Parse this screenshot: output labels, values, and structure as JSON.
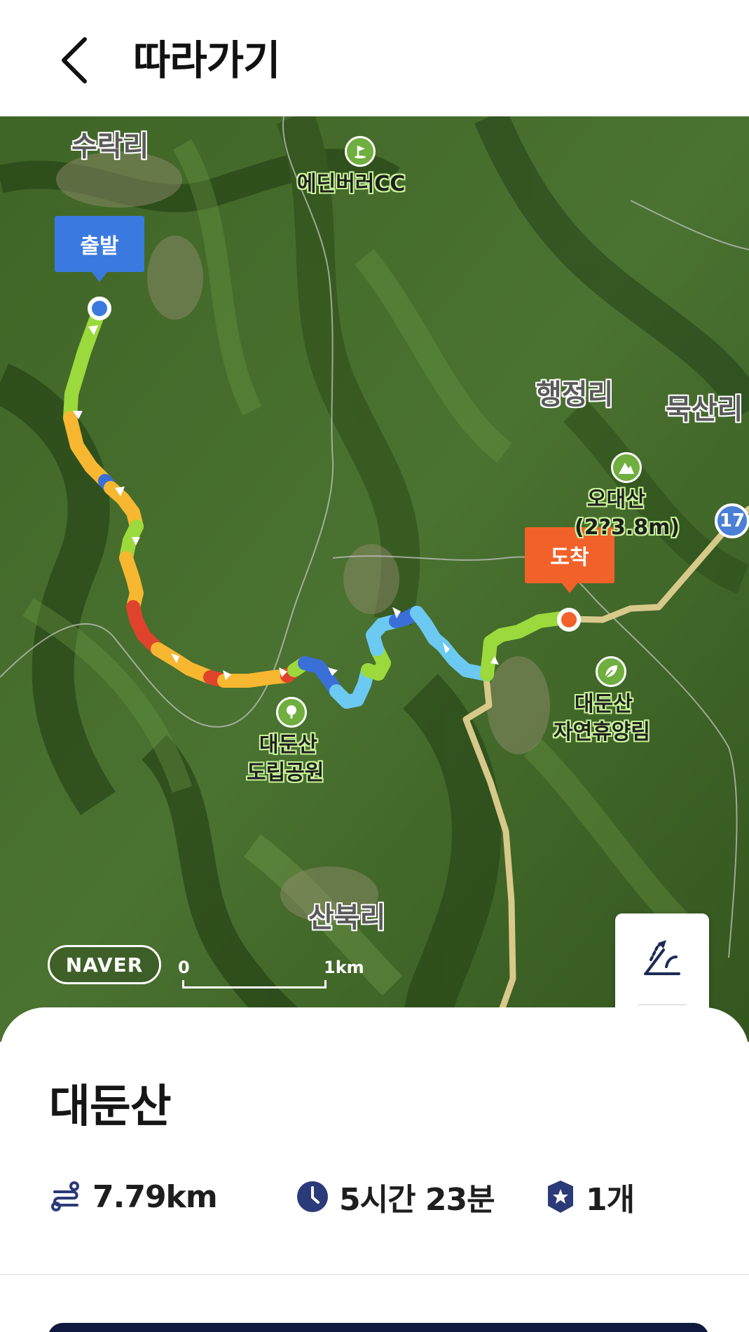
{
  "header": {
    "title": "따라가기",
    "back_icon": "chevron-left-icon"
  },
  "map": {
    "provider_logo": "NAVER",
    "scale": {
      "zero": "0",
      "distance": "1km"
    },
    "villages": [
      "수락리",
      "행정리",
      "묵산리",
      "산북리"
    ],
    "pois": {
      "golf": "에딘버러CC",
      "peak_name": "오대산",
      "peak_height": "(2?3.8m)",
      "forest_line1": "대둔산",
      "forest_line2": "자연휴양림",
      "park_line1": "대둔산",
      "park_line2": "도립공원"
    },
    "route_number": "17",
    "markers": {
      "start": "출발",
      "end": "도착"
    },
    "colors": {
      "start_marker": "#3a7ae0",
      "end_marker": "#f2612a",
      "road": "#d7c98a",
      "route_green": "#9bd93c",
      "route_yellow": "#f7b731",
      "route_red": "#e0432b",
      "route_blue": "#3a6fd8",
      "route_cyan": "#6cc9f2"
    },
    "controls": [
      "elevation-profile-icon",
      "reverse-route-icon"
    ]
  },
  "trail": {
    "name": "대둔산",
    "distance": "7.79km",
    "duration": "5시간 23분",
    "badge_count": "1개"
  }
}
